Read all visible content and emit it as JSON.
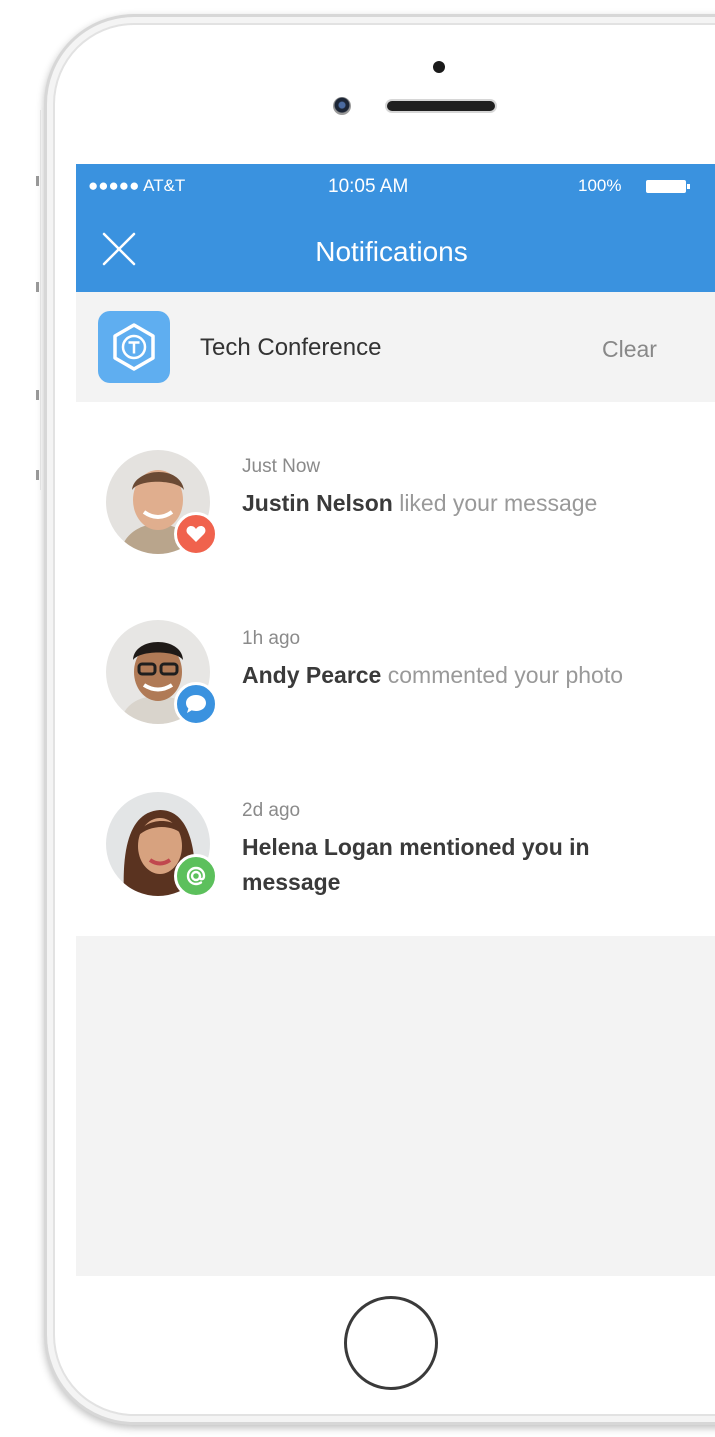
{
  "status_bar": {
    "carrier": "●●●●● AT&T",
    "time": "10:05 AM",
    "battery": "100%"
  },
  "header": {
    "title": "Notifications",
    "close_icon": "close-icon",
    "background_color": "#3a92df"
  },
  "section": {
    "title": "Tech Conference",
    "logo_icon": "hexagon-t-logo",
    "clear_label": "Clear"
  },
  "notifications": [
    {
      "time": "Just Now",
      "name": "Justin",
      "name_bold": "Nelson",
      "action": " liked your message",
      "badge": "heart-icon",
      "badge_color": "#f0624d"
    },
    {
      "time": "1h ago",
      "name": "Andy Pearce",
      "action": " commented your photo",
      "badge": "comment-icon",
      "badge_color": "#3a92df"
    },
    {
      "time": "2d ago",
      "name": "Helena Logan mentioned you in message",
      "badge": "at-icon",
      "badge_color": "#5cc05c"
    }
  ]
}
